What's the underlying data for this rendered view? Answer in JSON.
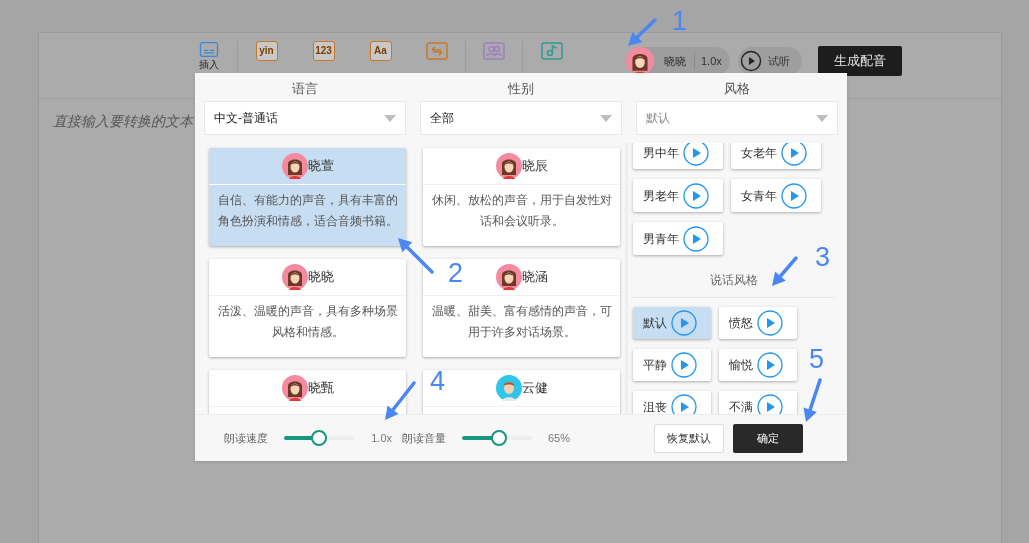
{
  "toolbar": {
    "tools": [
      {
        "kind": "caption",
        "label": "插入"
      },
      {
        "kind": "glyph",
        "glyph": "yin"
      },
      {
        "kind": "glyph",
        "glyph": "123"
      },
      {
        "kind": "glyph",
        "glyph": "Aa"
      },
      {
        "kind": "swap"
      },
      {
        "kind": "people"
      },
      {
        "kind": "music"
      }
    ],
    "voice": {
      "name": "晓晓",
      "speed": "1.0x"
    },
    "preview": {
      "label": "试听"
    },
    "generate": {
      "label": "生成配音"
    }
  },
  "editor": {
    "placeholder": "直接输入要转换的文本"
  },
  "dialog": {
    "filters": [
      {
        "label": "语言",
        "value": "中文-普通话"
      },
      {
        "label": "性别",
        "value": "全部"
      },
      {
        "label": "风格",
        "placeholder": "默认"
      }
    ],
    "voices": [
      {
        "name": "晓萱",
        "kind": "female",
        "selected": true,
        "description": "自信、有能力的声音，具有丰富的角色扮演和情感，适合音频书籍。"
      },
      {
        "name": "晓辰",
        "kind": "female",
        "selected": false,
        "description": "休闲、放松的声音，用于自发性对话和会议听录。"
      },
      {
        "name": "晓晓",
        "kind": "female",
        "selected": false,
        "description": "活泼、温暖的声音，具有多种场景风格和情感。"
      },
      {
        "name": "晓涵",
        "kind": "female",
        "selected": false,
        "description": "温暖、甜美、富有感情的声音，可用于许多对话场景。"
      },
      {
        "name": "晓甄",
        "kind": "female",
        "selected": false
      },
      {
        "name": "云健",
        "kind": "male",
        "selected": false
      }
    ],
    "roles": [
      {
        "label": "男中年"
      },
      {
        "label": "女老年"
      },
      {
        "label": "男老年"
      },
      {
        "label": "女青年"
      },
      {
        "label": "男青年"
      }
    ],
    "style_title": "说话风格",
    "styles": [
      {
        "label": "默认",
        "selected": true
      },
      {
        "label": "愤怒",
        "selected": false
      },
      {
        "label": "平静",
        "selected": false
      },
      {
        "label": "愉悦",
        "selected": false
      },
      {
        "label": "沮丧",
        "selected": false
      },
      {
        "label": "不满",
        "selected": false
      }
    ],
    "sliders": [
      {
        "label": "朗读速度",
        "level": 0.5,
        "reading": "1.0x"
      },
      {
        "label": "朗读音量",
        "level": 0.53,
        "reading": "65%"
      }
    ],
    "buttons": [
      {
        "label": "恢复默认",
        "kind": "secondary"
      },
      {
        "label": "确定",
        "kind": "primary"
      }
    ]
  },
  "annotations": [
    {
      "number": "1"
    },
    {
      "number": "2"
    },
    {
      "number": "3"
    },
    {
      "number": "4"
    },
    {
      "number": "5"
    }
  ]
}
